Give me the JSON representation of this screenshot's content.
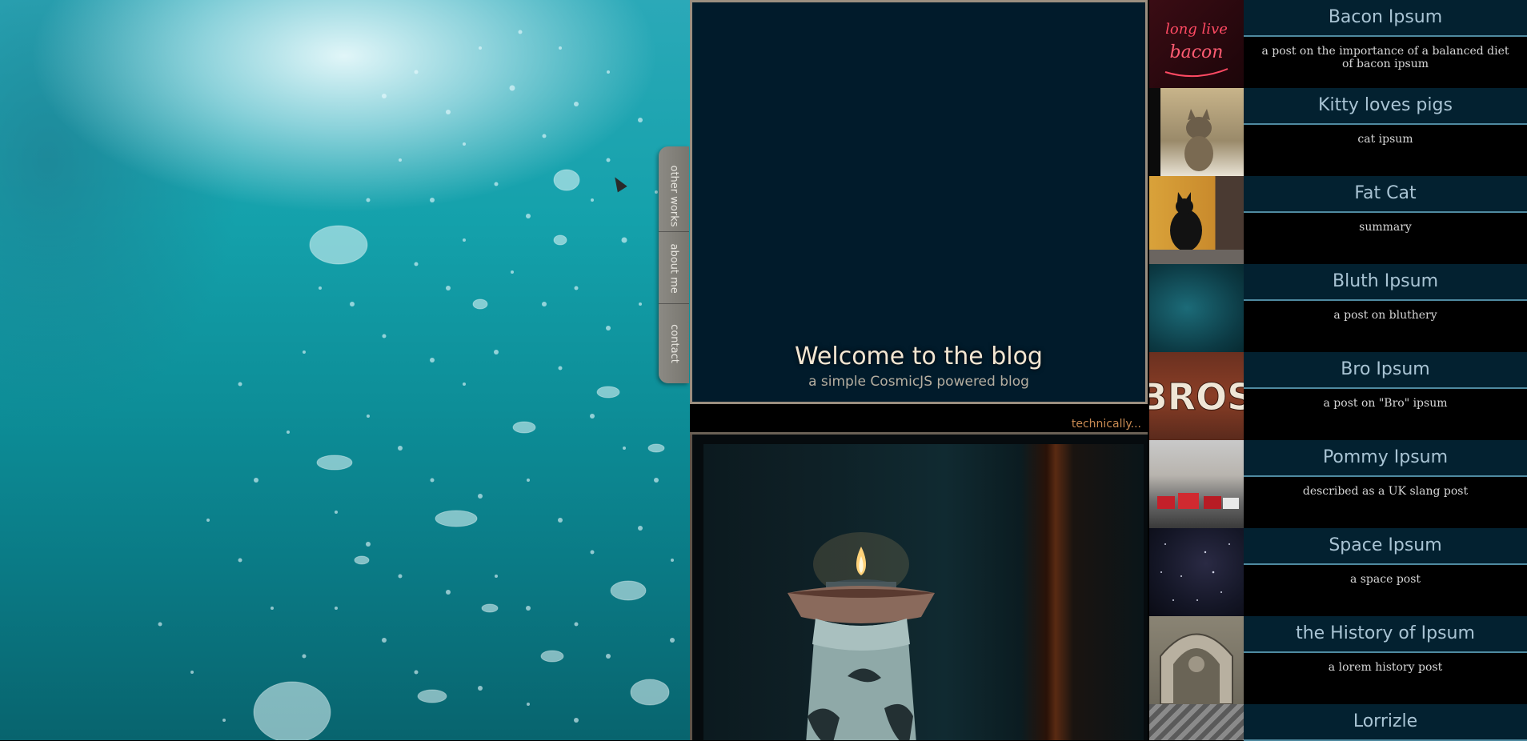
{
  "nav": {
    "tabs": [
      {
        "label": "other works"
      },
      {
        "label": "about me"
      },
      {
        "label": "contact"
      }
    ]
  },
  "hero": {
    "title": "Welcome to the blog",
    "subtitle": "a simple CosmicJS powered blog"
  },
  "footer_note": "technically...",
  "posts": [
    {
      "title": "Bacon Ipsum",
      "summary": "a post on the importance of a balanced diet of bacon ipsum"
    },
    {
      "title": "Kitty loves pigs",
      "summary": "cat ipsum"
    },
    {
      "title": "Fat Cat",
      "summary": "summary"
    },
    {
      "title": "Bluth Ipsum",
      "summary": "a post on bluthery"
    },
    {
      "title": "Bro Ipsum",
      "summary": "a post on \"Bro\" ipsum"
    },
    {
      "title": "Pommy Ipsum",
      "summary": "described as a UK slang post"
    },
    {
      "title": "Space Ipsum",
      "summary": "a space post"
    },
    {
      "title": "the History of Ipsum",
      "summary": "a lorem history post"
    },
    {
      "title": "Lorrizle",
      "summary": ""
    }
  ],
  "thumbnails": {
    "neon_sign_text": "long live bacon",
    "bros_sign_text": "BROS"
  },
  "colors": {
    "accent_title": "#a9c4d4",
    "panel_border": "#9b8f80",
    "footer_note": "#c88a52"
  }
}
